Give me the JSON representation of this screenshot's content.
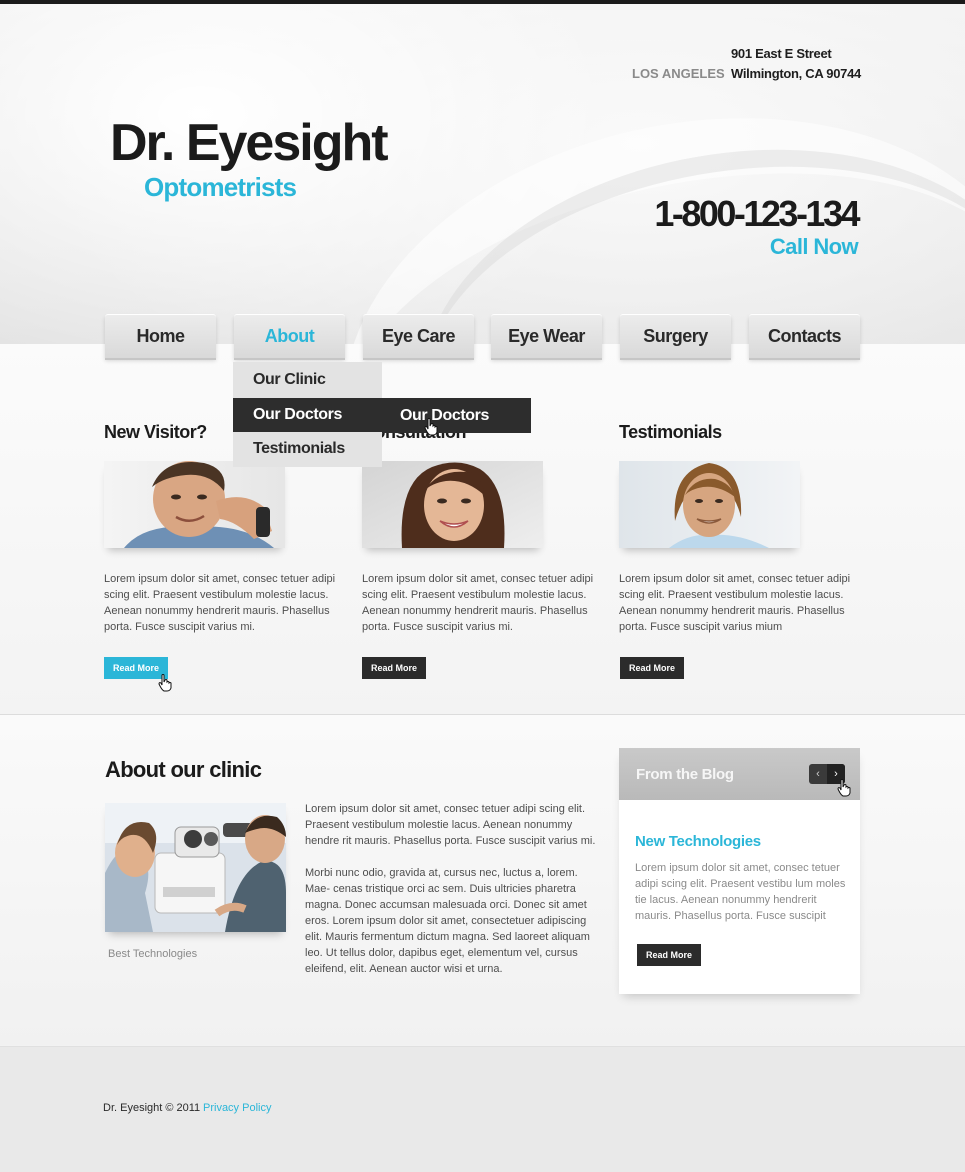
{
  "header": {
    "city": "LOS ANGELES",
    "street": "901 East E Street",
    "city_line": "Wilmington, CA 90744",
    "logo_title": "Dr. Eyesight",
    "logo_subtitle": "Optometrists",
    "phone": "1-800-123-134",
    "call_now": "Call Now"
  },
  "nav": {
    "items": [
      {
        "label": "Home"
      },
      {
        "label": "About"
      },
      {
        "label": "Eye Care"
      },
      {
        "label": "Eye Wear"
      },
      {
        "label": "Surgery"
      },
      {
        "label": "Contacts"
      }
    ],
    "active": "About",
    "dropdown": [
      "Our Clinic",
      "Our Doctors",
      "Testimonials"
    ],
    "submenu": [
      "Our Doctors"
    ]
  },
  "columns": [
    {
      "title": "New Visitor?",
      "text": "Lorem ipsum dolor sit amet, consec tetuer adipi scing elit. Praesent vestibulum molestie lacus. Aenean nonummy hendrerit mauris. Phasellus porta. Fusce suscipit varius mi.",
      "button": "Read More"
    },
    {
      "title": "Consultation",
      "text": "Lorem ipsum dolor sit amet, consec tetuer adipi scing elit. Praesent vestibulum molestie lacus. Aenean nonummy hendrerit mauris. Phasellus porta. Fusce suscipit varius mi.",
      "button": "Read More"
    },
    {
      "title": "Testimonials",
      "text": "Lorem ipsum dolor sit amet, consec tetuer adipi scing elit. Praesent vestibulum molestie lacus. Aenean nonummy hendrerit mauris. Phasellus porta. Fusce suscipit varius mium",
      "button": "Read More"
    }
  ],
  "about": {
    "title": "About our clinic",
    "caption": "Best Technologies",
    "p1": "Lorem ipsum dolor sit amet, consec tetuer adipi scing elit. Praesent vestibulum molestie lacus. Aenean nonummy hendre rit mauris. Phasellus porta. Fusce suscipit varius mi.",
    "p2": "Morbi nunc odio, gravida at, cursus nec, luctus a, lorem. Mae- cenas tristique orci ac sem. Duis ultricies pharetra magna. Donec accumsan malesuada orci. Donec sit amet eros. Lorem ipsum dolor sit amet, consectetuer adipiscing elit. Mauris fermentum dictum magna. Sed laoreet aliquam leo. Ut tellus dolor, dapibus eget, elementum vel, cursus eleifend, elit. Aenean auctor wisi et urna."
  },
  "blog": {
    "title": "From the Blog",
    "prev_icon": "‹",
    "next_icon": "›",
    "post_title": "New Technologies",
    "post_text": "Lorem ipsum dolor sit amet, consec tetuer adipi scing elit. Praesent vestibu lum moles tie lacus. Aenean nonummy hendrerit mauris. Phasellus porta. Fusce suscipit",
    "button": "Read More"
  },
  "footer": {
    "copyright": "Dr. Eyesight © 2011",
    "privacy": "Privacy Policy"
  },
  "colors": {
    "accent": "#2bb6d8",
    "dark": "#1b1b1b",
    "button_dark": "#2b2b2b"
  }
}
